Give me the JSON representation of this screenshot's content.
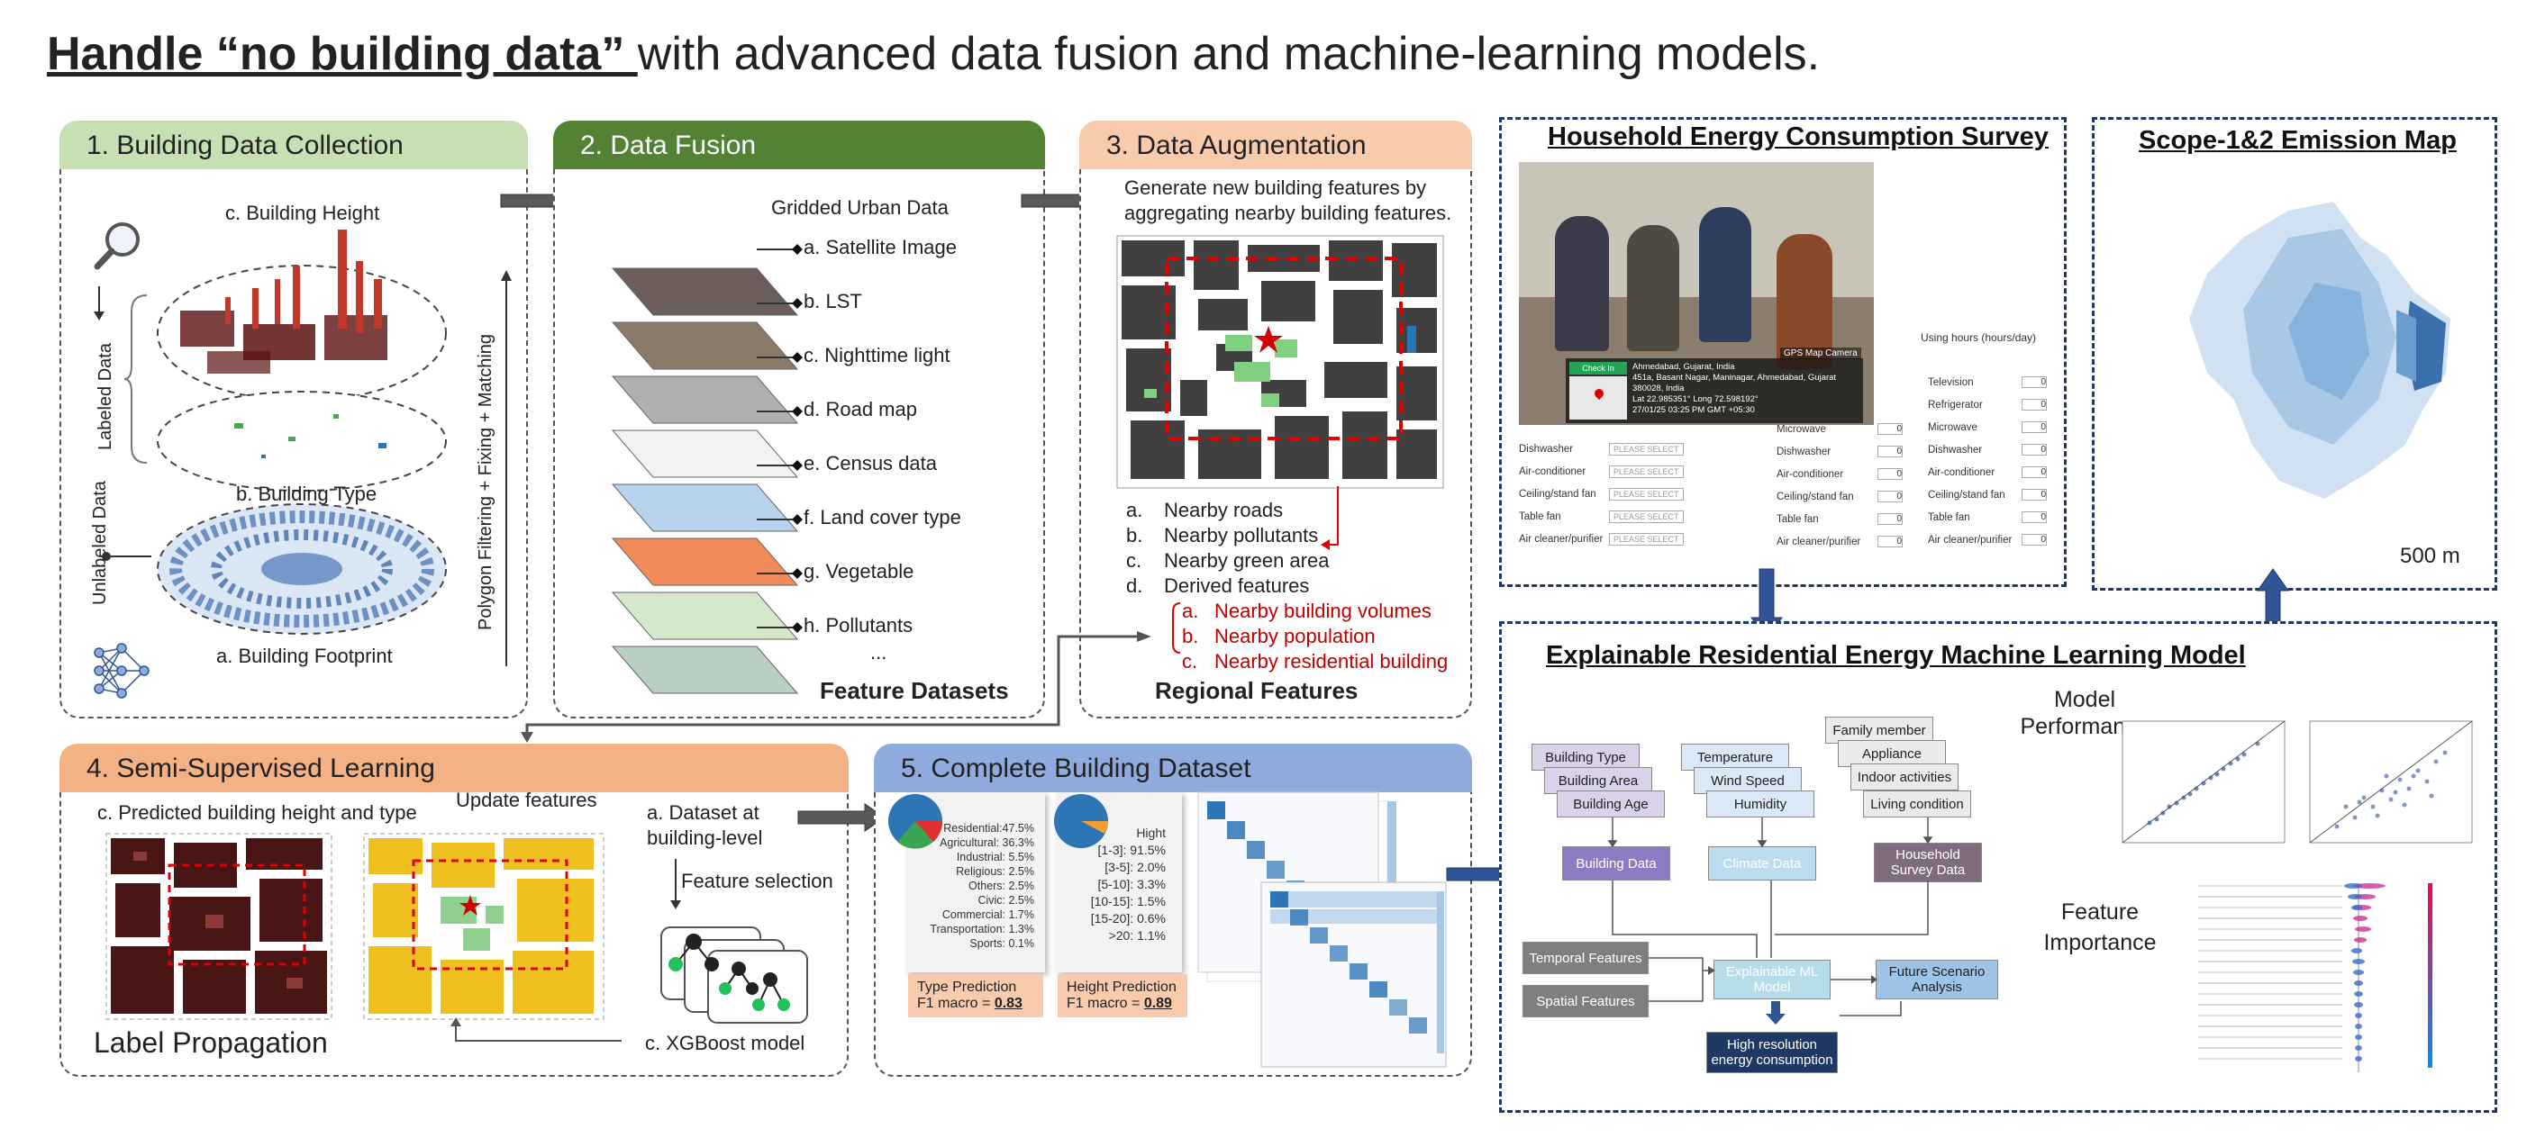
{
  "title": {
    "underlined": "Handle “no building data” ",
    "rest": "with advanced data fusion and machine-learning models."
  },
  "panel1": {
    "header": "1. Building Data Collection",
    "building_height": "c. Building Height",
    "building_type": "b. Building Type",
    "building_footprint": "a. Building Footprint",
    "labeled": "Labeled Data",
    "unlabeled": "Unlabeled Data",
    "polygon": "Polygon Filtering + Fixing + Matching"
  },
  "panel2": {
    "header": "2. Data Fusion",
    "gridded": "Gridded Urban Data",
    "layers": [
      "a. Satellite Image",
      "b. LST",
      "c. Nighttime light",
      "d. Road map",
      "e. Census data",
      "f. Land cover type",
      "g. Vegetable",
      "h. Pollutants"
    ],
    "ellipsis": "...",
    "footer": "Feature Datasets"
  },
  "panel3": {
    "header": "3. Data Augmentation",
    "desc1": "Generate new building features by",
    "desc2": "aggregating nearby building features.",
    "items": [
      {
        "letter": "a.",
        "text": "Nearby roads"
      },
      {
        "letter": "b.",
        "text": "Nearby pollutants"
      },
      {
        "letter": "c.",
        "text": "Nearby green area"
      },
      {
        "letter": "d.",
        "text": "Derived features"
      }
    ],
    "derived": [
      {
        "letter": "a.",
        "text": "Nearby building volumes"
      },
      {
        "letter": "b.",
        "text": "Nearby population"
      },
      {
        "letter": "c.",
        "text": "Nearby residential building"
      }
    ],
    "footer": "Regional Features"
  },
  "panel4": {
    "header": "4. Semi-Supervised Learning",
    "predicted": "c. Predicted building height and type",
    "update": "Update features",
    "dataset1": "a. Dataset at",
    "dataset2": "building-level",
    "feature_selection": "Feature selection",
    "label_propagation": "Label Propagation",
    "xgboost": "c. XGBoost model"
  },
  "panel5": {
    "header": "5. Complete Building Dataset",
    "type_breakdown": [
      "Residential:47.5%",
      "Agricultural: 36.3%",
      "Industrial: 5.5%",
      "Religious: 2.5%",
      "Others: 2.5%",
      "Civic: 2.5%",
      "Commercial: 1.7%",
      "Transportation: 1.3%",
      "Sports: 0.1%"
    ],
    "height_title": "Hight",
    "height_breakdown": [
      "[1-3]: 91.5%",
      "[3-5]: 2.0%",
      "[5-10]: 3.3%",
      "[10-15]: 1.5%",
      "[15-20]: 0.6%",
      ">20: 1.1%"
    ],
    "type_pred": "Type Prediction",
    "type_f1_label": "F1 macro = ",
    "type_f1": "0.83",
    "height_pred": "Height Prediction",
    "height_f1_label": "F1 macro = ",
    "height_f1": "0.89"
  },
  "survey": {
    "title": "Household Energy Consumption Survey",
    "usage_header": "Using hours (hours/day)",
    "photo_caption": [
      "Ahmedabad, Gujarat, India",
      "451a, Basant Nagar, Maninagar, Ahmedabad, Gujarat 380028, India",
      "Lat 22.985351° Long 72.598192°",
      "27/01/25 03:25 PM GMT +05:30"
    ],
    "check_in": "Check In",
    "gps": "GPS Map Camera",
    "select_placeholder": "PLEASE SELECT",
    "col1": [
      "Dishwasher",
      "Air-conditioner",
      "Ceiling/stand fan",
      "Table fan",
      "Air cleaner/purifier"
    ],
    "col2": [
      "Microwave",
      "Dishwasher",
      "Air-conditioner",
      "Ceiling/stand fan",
      "Table fan",
      "Air cleaner/purifier"
    ],
    "col3": [
      "Television",
      "Refrigerator",
      "Microwave",
      "Dishwasher",
      "Air-conditioner",
      "Ceiling/stand fan",
      "Table fan",
      "Air cleaner/purifier"
    ],
    "zero": "0"
  },
  "emission": {
    "title": "Scope-1&2 Emission Map",
    "scale": "500 m"
  },
  "ml": {
    "title": "Explainable Residential Energy Machine Learning Model",
    "building_type": "Building Type",
    "building_area": "Building Area",
    "building_age": "Building Age",
    "building_data": "Building Data",
    "temperature": "Temperature",
    "wind_speed": "Wind Speed",
    "humidity": "Humidity",
    "climate_data": "Climate Data",
    "family_member": "Family member",
    "appliance": "Appliance",
    "indoor": "Indoor activities",
    "living": "Living condition",
    "survey_data": "Household Survey Data",
    "temporal": "Temporal Features",
    "spatial": "Spatial Features",
    "explainable": "Explainable ML Model",
    "future": "Future Scenario Analysis",
    "high_res": "High resolution energy consumption",
    "model_perf": "Model Performance",
    "feature_imp": "Feature Importance"
  },
  "colors": {
    "green_header": "#c6e0b4",
    "darkgreen_header": "#548235",
    "orange_header": "#f8cbad",
    "blue_header": "#8faadc",
    "navy": "#1f3864",
    "red_text": "#c00000"
  }
}
